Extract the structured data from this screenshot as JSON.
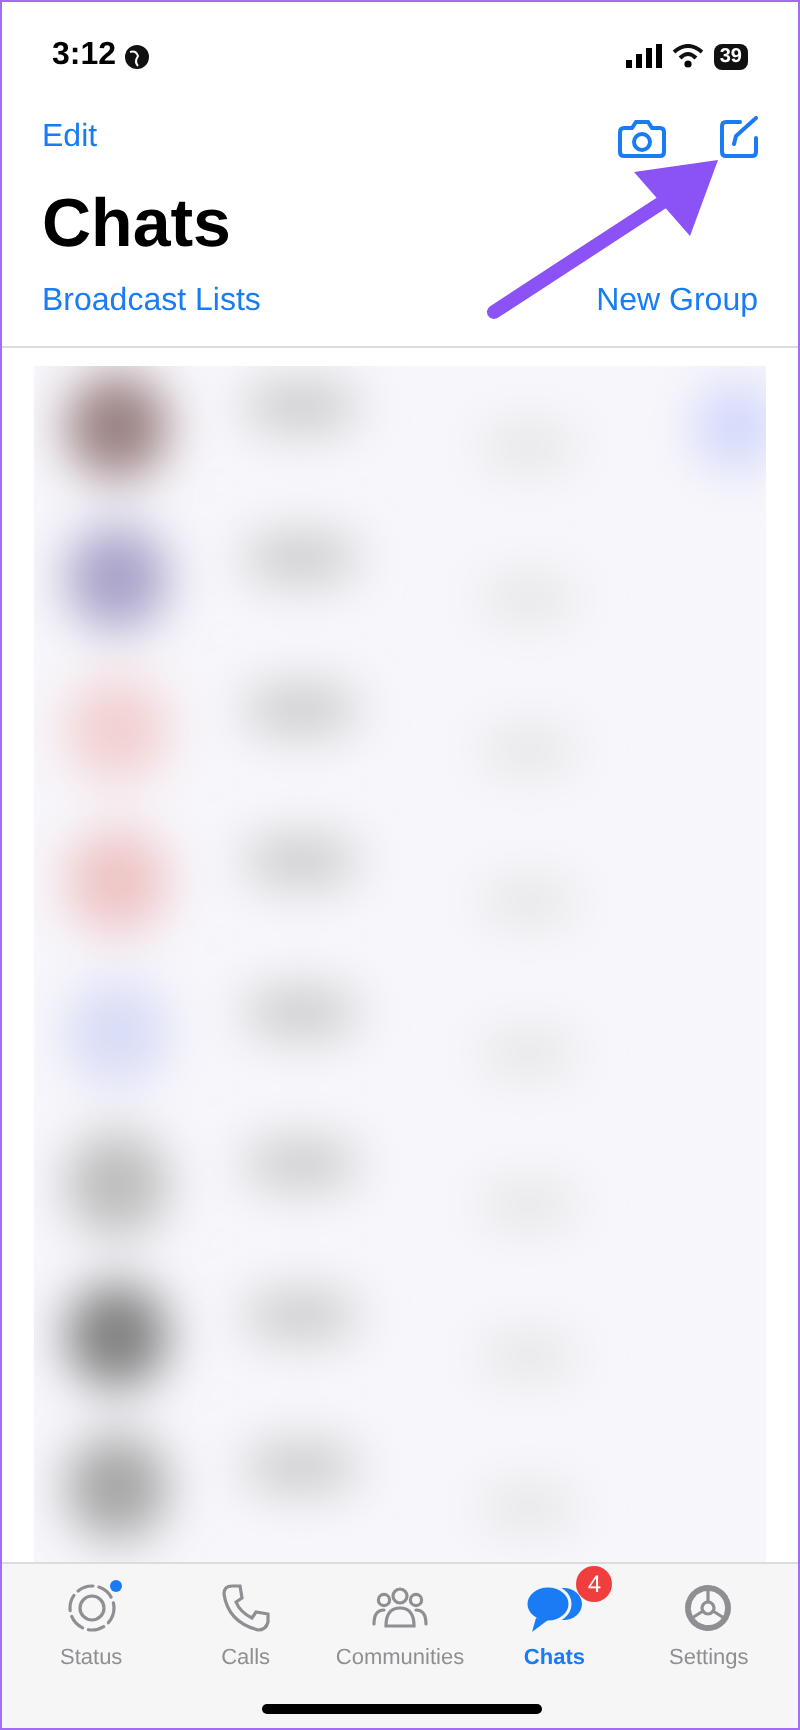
{
  "status_bar": {
    "time": "3:12",
    "battery": "39"
  },
  "nav": {
    "left_action": "Edit"
  },
  "title": "Chats",
  "links": {
    "left": "Broadcast Lists",
    "right": "New Group"
  },
  "tab_bar": [
    {
      "kind": "status",
      "label": "Status",
      "selected": false,
      "dot": true
    },
    {
      "kind": "calls",
      "label": "Calls",
      "selected": false,
      "dot": false
    },
    {
      "kind": "communities",
      "label": "Communities",
      "selected": false,
      "dot": false
    },
    {
      "kind": "chats",
      "label": "Chats",
      "selected": true,
      "dot": false,
      "badge": "4"
    },
    {
      "kind": "settings",
      "label": "Settings",
      "selected": false,
      "dot": false
    }
  ]
}
